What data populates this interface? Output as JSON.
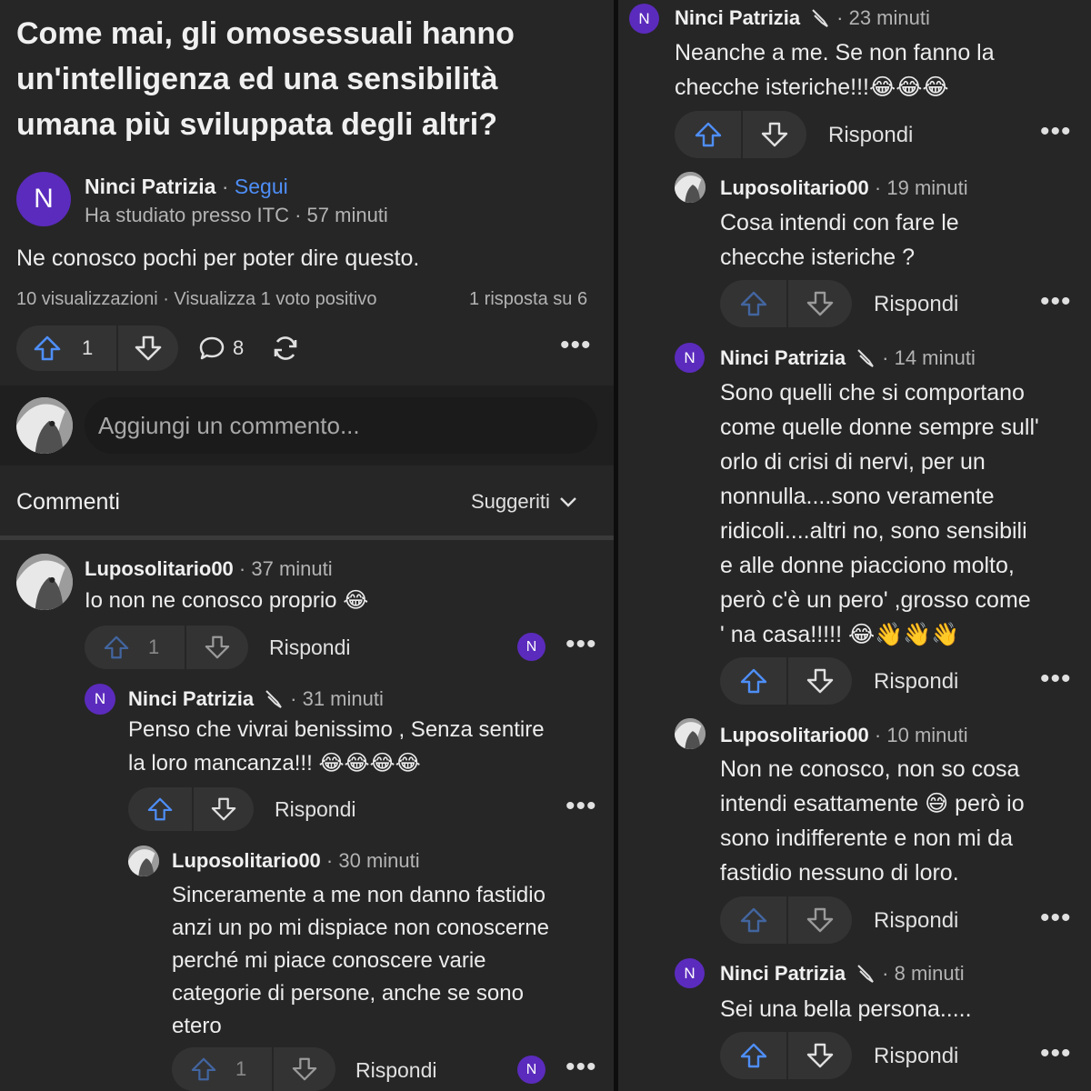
{
  "question": {
    "title": "Come mai, gli omosessuali hanno un'intelligenza ed una sensibilità umana più sviluppata degli altri?"
  },
  "answer": {
    "author": "Ninci Patrizia",
    "separator": " · ",
    "follow": "Segui",
    "credential": "Ha studiato presso ITC · 57 minuti",
    "text": "Ne conosco pochi per poter dire questo.",
    "views": "10 visualizzazioni · Visualizza 1 voto positivo",
    "answer_index": "1 risposta su 6",
    "upvotes": "1",
    "comments_count": "8",
    "avatar_letter": "N"
  },
  "add_comment": {
    "placeholder": "Aggiungi un commento..."
  },
  "comments_header": {
    "title": "Commenti",
    "sort": "Suggeriti"
  },
  "reply_label": "Rispondi",
  "comments": [
    {
      "author": "Luposolitario00",
      "time": "· 37 minuti",
      "text": "Io non ne conosco proprio 😂",
      "upvotes": "1"
    },
    {
      "author": "Ninci Patrizia",
      "time": "· 31 minuti",
      "line1": "Penso che vivrai benissimo , Senza sentire",
      "line2": "la loro mancanza!!! 😂😂😂😂"
    },
    {
      "author": "Luposolitario00",
      "time": "· 30 minuti",
      "lines": [
        "Sinceramente a me non danno fastidio",
        "anzi un po mi dispiace non conoscerne",
        "perché mi piace conoscere varie",
        "categorie di persone, anche se sono",
        "etero"
      ],
      "upvotes": "1"
    },
    {
      "author": "Ninci Patrizia",
      "time": "· 23 minuti",
      "lines": [
        "Neanche a me. Se non fanno la",
        "checche isteriche!!!😂😂😂"
      ]
    },
    {
      "author": "Luposolitario00",
      "time": "· 19 minuti",
      "lines": [
        "Cosa intendi con fare le",
        "checche isteriche ?"
      ]
    },
    {
      "author": "Ninci Patrizia",
      "time": "· 14 minuti",
      "lines": [
        "Sono quelli che si comportano",
        "come quelle donne sempre sull'",
        "orlo di crisi di nervi, per un",
        "nonnulla....sono veramente",
        "ridicoli....altri no, sono sensibili",
        "e alle donne piacciono molto,",
        "però c'è un pero' ,grosso come",
        "' na casa!!!!! 😂👋👋👋"
      ]
    },
    {
      "author": "Luposolitario00",
      "time": "· 10 minuti",
      "lines": [
        "Non ne conosco, non so cosa",
        "intendi esattamente 😅 però io",
        "sono indifferente e non mi da",
        "fastidio nessuno di loro."
      ]
    },
    {
      "author": "Ninci Patrizia",
      "time": "· 8 minuti",
      "lines": [
        "Sei una bella persona....."
      ]
    }
  ],
  "colors": {
    "accent": "#4e8ef7",
    "avatar": "#5b2bbd",
    "background": "#262626"
  },
  "icons": [
    "upvote-icon",
    "downvote-icon",
    "comment-icon",
    "share-icon",
    "more-icon",
    "chevron-down-icon",
    "moderator-icon"
  ]
}
